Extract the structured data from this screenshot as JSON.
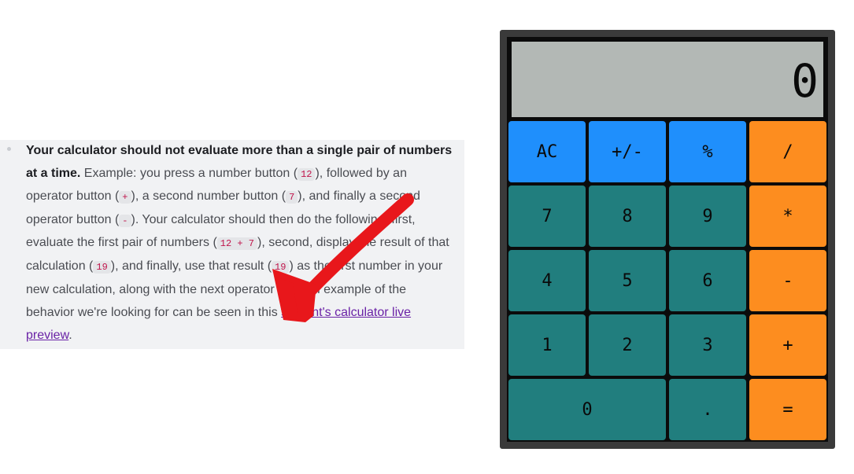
{
  "note": {
    "bold_lead": "Your calculator should not evaluate more than a single pair of numbers at a time.",
    "t1": " Example: you press a number button (",
    "c1": "12",
    "t2": "), followed by an operator button (",
    "c2": "+",
    "t3": "), a second number button (",
    "c3": "7",
    "t4": "), and finally a second operator button (",
    "c4": "-",
    "t5": "). Your calculator should then do the following: first, evaluate the first pair of numbers (",
    "c5": "12 + 7",
    "t6": "), second, display the result of that calculation (",
    "c6": "19",
    "t7": "), and finally, use that result (",
    "c7": "19",
    "t8": ") as the first number in your new calculation, along with the next operator (",
    "c8": "-",
    "t9": "). An example of the behavior we're looking for can be seen in this ",
    "link": "student's calculator live preview",
    "t10": "."
  },
  "calculator": {
    "display": "0",
    "keys": {
      "ac": "AC",
      "sign": "+/-",
      "percent": "%",
      "divide": "/",
      "seven": "7",
      "eight": "8",
      "nine": "9",
      "multiply": "*",
      "four": "4",
      "five": "5",
      "six": "6",
      "subtract": "-",
      "one": "1",
      "two": "2",
      "three": "3",
      "add": "+",
      "zero": "0",
      "decimal": ".",
      "equals": "="
    }
  },
  "colors": {
    "function_key": "#1f8ffc",
    "number_key": "#217e7e",
    "operator_key": "#fd8d1f",
    "display_bg": "#b3b8b5",
    "annotation_arrow": "#e8171b"
  },
  "icons": {
    "annotation": "red-arrow-icon"
  }
}
